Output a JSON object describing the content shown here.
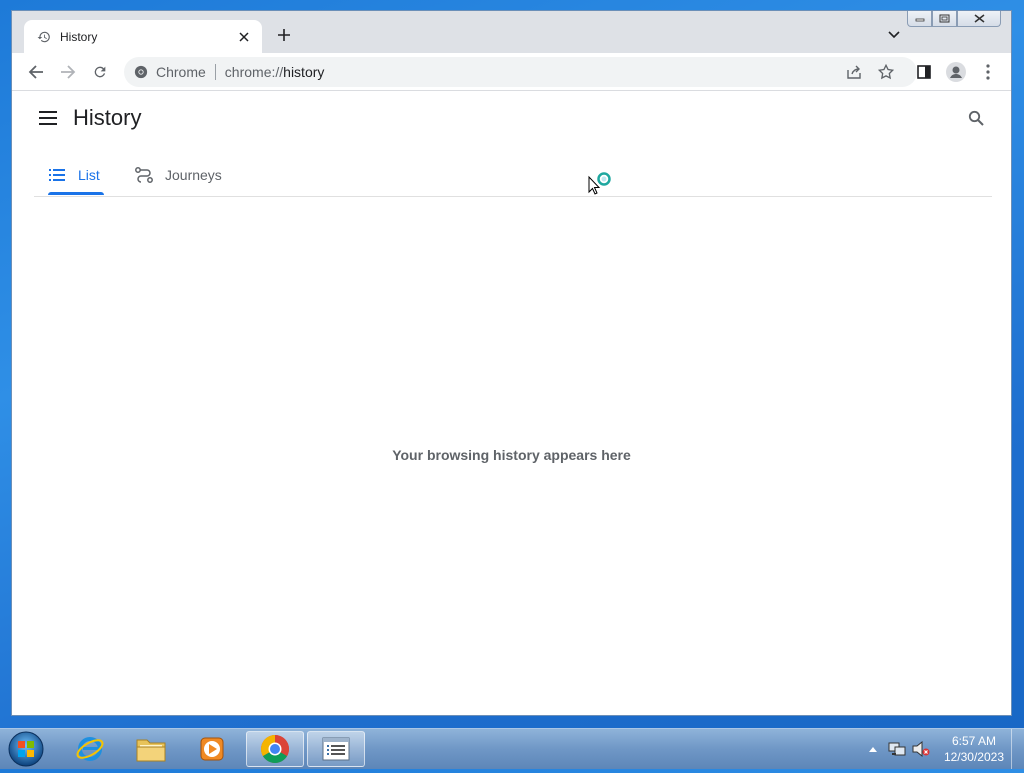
{
  "browser": {
    "tab_title": "History",
    "omnibox_chip": "Chrome",
    "url_scheme": "chrome://",
    "url_path": "history"
  },
  "page": {
    "title": "History",
    "tabs": [
      {
        "label": "List",
        "icon": "list-icon",
        "selected": true
      },
      {
        "label": "Journeys",
        "icon": "journeys-icon",
        "selected": false
      }
    ],
    "empty_message": "Your browsing history appears here"
  },
  "taskbar": {
    "apps": [
      "internet-explorer-icon",
      "folder-icon",
      "media-player-icon",
      "chrome-icon",
      "task-list-icon"
    ],
    "active_app": "chrome-icon",
    "time": "6:57 AM",
    "date": "12/30/2023"
  },
  "colors": {
    "accent": "#1a73e8",
    "tabstrip": "#dee1e6",
    "omnibox": "#f1f3f4",
    "text_secondary": "#5f6368"
  }
}
